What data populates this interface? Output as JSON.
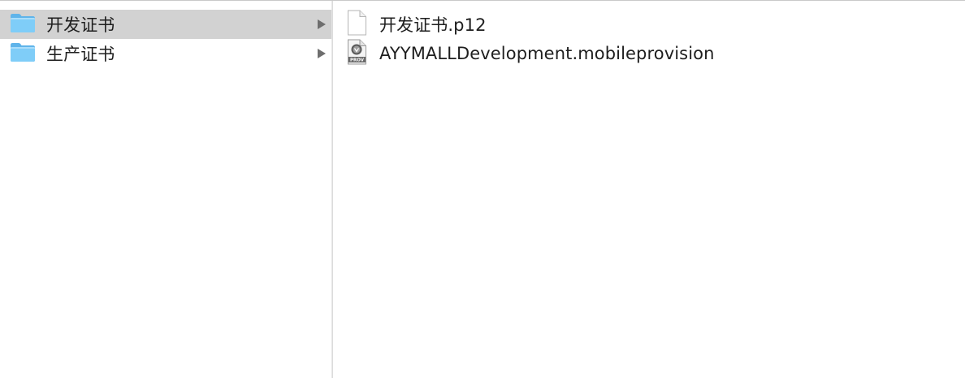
{
  "column1": {
    "items": [
      {
        "label": "开发证书",
        "icon": "folder-icon",
        "selected": true
      },
      {
        "label": "生产证书",
        "icon": "folder-icon",
        "selected": false
      }
    ]
  },
  "column2": {
    "items": [
      {
        "label": "开发证书.p12",
        "icon": "blank-document-icon"
      },
      {
        "label": "AYYMALLDevelopment.mobileprovision",
        "icon": "provisioning-profile-icon",
        "icon_text": "PROV"
      }
    ]
  },
  "colors": {
    "selection": "#d2d2d2",
    "folder": "#6cc3f5",
    "text": "#1e1e1e"
  }
}
